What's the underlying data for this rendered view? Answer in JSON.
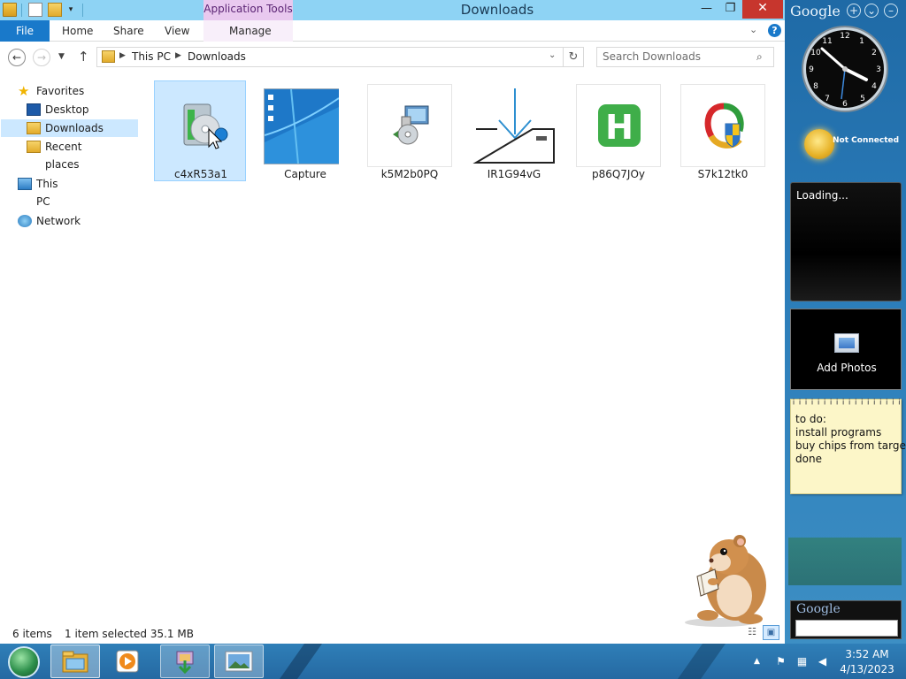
{
  "window": {
    "title": "Downloads",
    "contextual_tab_group": "Application Tools",
    "controls": {
      "minimize": "—",
      "maximize": "❐",
      "close": "✕"
    }
  },
  "ribbon": {
    "tabs": [
      "File",
      "Home",
      "Share",
      "View",
      "Manage"
    ],
    "help": "?"
  },
  "navigation": {
    "breadcrumb": [
      "This PC",
      "Downloads"
    ],
    "search_placeholder": "Search Downloads"
  },
  "nav_pane": {
    "favorites": "Favorites",
    "favorite_items": [
      "Desktop",
      "Downloads",
      "Recent places"
    ],
    "this_pc": "This PC",
    "network": "Network",
    "selected": "Downloads"
  },
  "files": [
    {
      "name": "c4xR53a1",
      "icon": "installer-disc-icon",
      "selected": true
    },
    {
      "name": "Capture",
      "icon": "screenshot-thumbnail",
      "selected": false
    },
    {
      "name": "k5M2b0PQ",
      "icon": "setup-computer-icon",
      "selected": false
    },
    {
      "name": "IR1G94vG",
      "icon": "download-tray-icon",
      "selected": false
    },
    {
      "name": "p86Q7JOy",
      "icon": "green-h-app-icon",
      "selected": false
    },
    {
      "name": "S7k12tk0",
      "icon": "colorful-shield-app-icon",
      "selected": false
    }
  ],
  "status": {
    "item_count": "6 items",
    "selection": "1 item selected  35.1 MB"
  },
  "gadgets": {
    "brand": "Google",
    "weather_status": "Not Connected",
    "feed_status": "Loading...",
    "photos_label": "Add Photos",
    "notes": [
      "to do:",
      "install programs",
      "buy chips from target",
      "done"
    ],
    "search_brand": "Google"
  },
  "taskbar": {
    "time": "3:52 AM",
    "date": "4/13/2023",
    "pinned": [
      "file-explorer-icon",
      "media-player-icon",
      "installer-icon",
      "photo-viewer-icon"
    ]
  },
  "colors": {
    "accent": "#1979ca",
    "titlebar": "#8ed3f4",
    "selection": "#cce8ff",
    "contextual_tab": "#e9c9ef",
    "close": "#c7362d"
  }
}
